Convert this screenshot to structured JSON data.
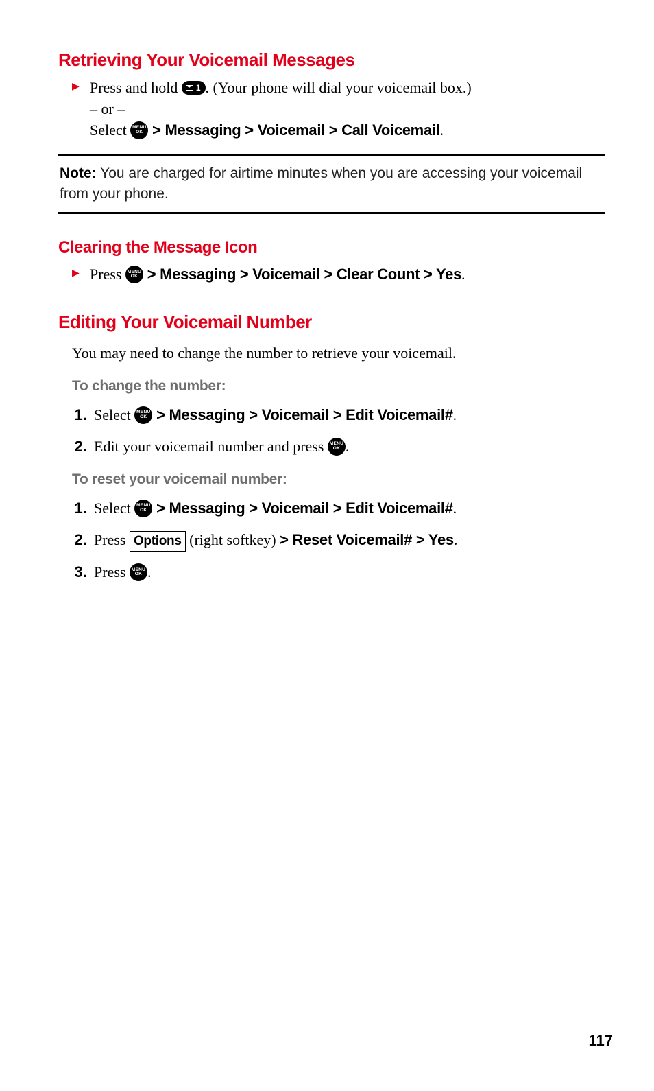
{
  "section1": {
    "heading": "Retrieving Your Voicemail Messages",
    "b1_t1": "Press and hold ",
    "b1_key_digit": "1",
    "b1_t2": ". (Your phone will dial your voicemail box.)",
    "b1_or": "– or –",
    "b1_select": "Select ",
    "menu_top": "MENU",
    "menu_bot": "OK",
    "b1_path": " > Messaging > Voicemail > Call Voicemail",
    "b1_end": "."
  },
  "note": {
    "label": "Note:",
    "text": " You are charged for airtime minutes when you are accessing your voicemail from your phone."
  },
  "section2": {
    "heading": "Clearing the Message Icon",
    "b1_t1": "Press ",
    "b1_path": " > Messaging > Voicemail > Clear Count > Yes",
    "b1_end": "."
  },
  "section3": {
    "heading": "Editing Your Voicemail Number",
    "intro": "You may need to change the number to retrieve your voicemail.",
    "sub1": "To change the number:",
    "s1_1a": "Select ",
    "s1_1b": " > Messaging > Voicemail > Edit Voicemail#",
    "s1_1c": ".",
    "s1_2a": "Edit your voicemail number and press ",
    "s1_2b": ".",
    "sub2": "To reset your voicemail number:",
    "s2_1a": "Select ",
    "s2_1b": " > Messaging > Voicemail > Edit Voicemail#",
    "s2_1c": ".",
    "s2_2a": "Press ",
    "s2_2box": "Options",
    "s2_2b": " (right softkey) ",
    "s2_2path": "> Reset Voicemail# > Yes",
    "s2_2c": ".",
    "s2_3a": "Press ",
    "s2_3b": "."
  },
  "page_number": "117"
}
